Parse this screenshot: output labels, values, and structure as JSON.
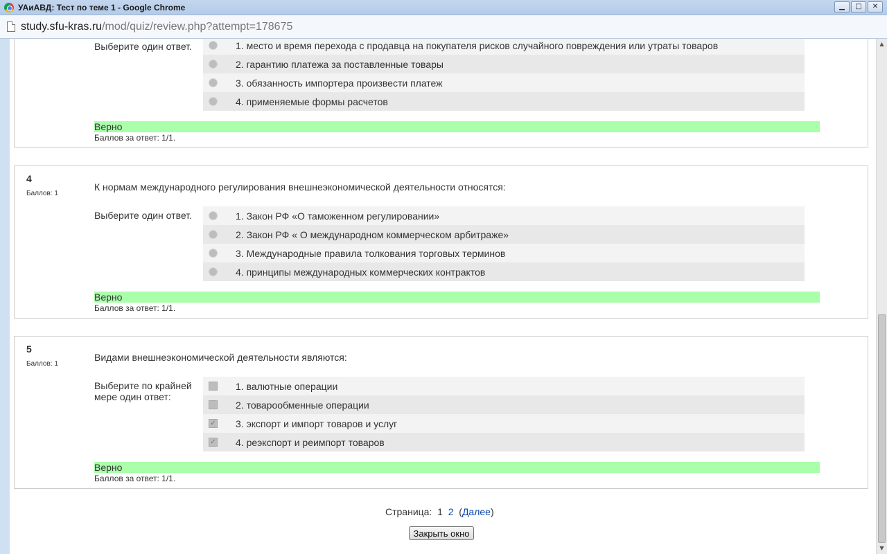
{
  "window": {
    "title": "УАиАВД: Тест по теме 1 - Google Chrome",
    "controls": {
      "minimize": "▁",
      "maximize": "□",
      "close": "✕"
    }
  },
  "address": {
    "host": "study.sfu-kras.ru",
    "path": "/mod/quiz/review.php?attempt=178675"
  },
  "questions": [
    {
      "prompt": "Выберите один ответ.",
      "input_type": "radio",
      "options": [
        "1. место и время перехода с продавца на покупателя рисков случайного повреждения или утраты товаров",
        "2. гарантию платежа за поставленные товары",
        "3. обязанность импортера произвести платеж",
        "4. применяемые формы расчетов"
      ],
      "result": "Верно",
      "grade": "Баллов за ответ: 1/1."
    },
    {
      "number": "4",
      "score_label": "Баллов: 1",
      "text": "К нормам международного регулирования внешнеэкономической деятельности относятся:",
      "prompt": "Выберите один ответ.",
      "input_type": "radio",
      "options": [
        "1. Закон РФ «О таможенном регулировании»",
        "2. Закон РФ « О международном коммерческом арбитраже»",
        "3. Международные правила толкования торговых терминов",
        "4. принципы международных коммерческих контрактов"
      ],
      "result": "Верно",
      "grade": "Баллов за ответ: 1/1."
    },
    {
      "number": "5",
      "score_label": "Баллов: 1",
      "text": "Видами внешнеэкономической деятельности являются:",
      "prompt": "Выберите по крайней мере один ответ:",
      "input_type": "checkbox",
      "options": [
        "1. валютные операции",
        "2. товарообменные операции",
        "3. экспорт и импорт товаров и услуг",
        "4. реэкспорт и реимпорт товаров"
      ],
      "checked": [
        false,
        false,
        true,
        true
      ],
      "result": "Верно",
      "grade": "Баллов за ответ: 1/1."
    }
  ],
  "pager": {
    "label": "Страница:",
    "page1": "1",
    "page2": "2",
    "next": "Далее"
  },
  "close_button": "Закрыть окно"
}
